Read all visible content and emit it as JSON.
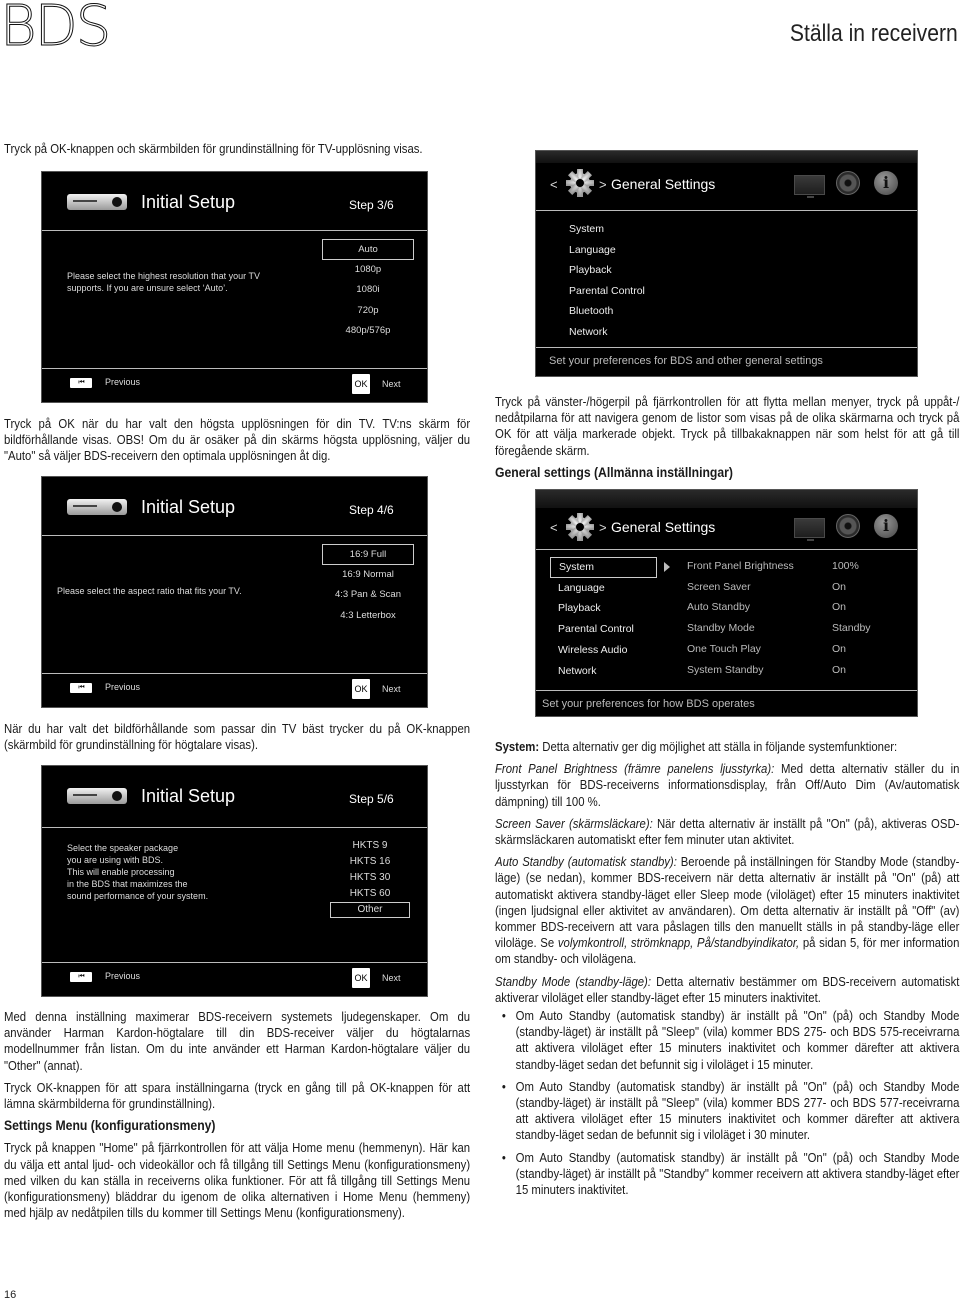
{
  "header": {
    "brand": "BDS",
    "section_title": "Ställa in receivern"
  },
  "left": {
    "intro": "Tryck på OK-knappen och skärmbilden för grundinställning för TV-upplösning visas.",
    "after_step3": "Tryck på OK när du har valt den högsta upplösningen för din TV. TV:ns skärm för bildförhållande visas. OBS! Om du är osäker på din skärms högsta upplösning, väljer du \"Auto\" så väljer BDS-receivern den optimala upplösningen åt dig.",
    "after_step4": "När du har valt det bildförhållande som passar din TV bäst trycker du på OK-knappen (skärmbild för grundinställning för högtalare visas).",
    "after_step5_a": "Med denna inställning maximerar BDS-receivern systemets ljudegenskaper. Om du använder Harman Kardon-högtalare till din BDS-receiver väljer du högtalarnas modellnummer från listan. Om du inte använder ett Harman Kardon-högtalare väljer du \"Other\" (annat).",
    "after_step5_b": "Tryck OK-knappen för att spara inställningarna (tryck en gång till på OK-knappen för att lämna skärmbilderna för grundinställning).",
    "settings_heading": "Settings Menu (konfigurationsmeny)",
    "settings_body": "Tryck på knappen \"Home\" på fjärrkontrollen för att välja Home menu (hemmenyn). Här kan du välja ett antal ljud- och videokällor och få tillgång till Settings Menu (konfigurationsmeny) med vilken du kan ställa in receiverns olika funktioner. För att få tillgång till Settings Menu (konfigurationsmeny) bläddrar du igenom de olika alternativen i Home Menu (hemmeny) med hjälp av nedåtpilen tills du kommer till Settings Menu (konfigurationsmeny)."
  },
  "setup_screens": [
    {
      "title": "Initial Setup",
      "step": "Step 3/6",
      "message": "Please select the highest resolution that your TV supports. If you are unsure select ‘Auto’.",
      "options": [
        "Auto",
        "1080p",
        "1080i",
        "720p",
        "480p/576p"
      ],
      "selected": 0,
      "prev_icon": "⏮",
      "prev_label": "Previous",
      "ok_label": "OK",
      "next_label": "Next"
    },
    {
      "title": "Initial Setup",
      "step": "Step 4/6",
      "message": "Please select the aspect ratio that fits your TV.",
      "options": [
        "16:9 Full",
        "16:9 Normal",
        "4:3 Pan & Scan",
        "4:3 Letterbox"
      ],
      "selected": 0,
      "prev_icon": "⏮",
      "prev_label": "Previous",
      "ok_label": "OK",
      "next_label": "Next"
    },
    {
      "title": "Initial Setup",
      "step": "Step 5/6",
      "message_lines": [
        "Select the speaker package",
        "you are using with BDS.",
        "This will enable processing",
        "in the BDS that maximizes the",
        "sound performance of your system."
      ],
      "options": [
        "HKTS 9",
        "HKTS 16",
        "HKTS 30",
        "HKTS 60",
        "Other"
      ],
      "selected": 4,
      "prev_icon": "⏮",
      "prev_label": "Previous",
      "ok_label": "OK",
      "next_label": "Next"
    }
  ],
  "general_settings_1": {
    "back": "<",
    "forward": ">",
    "title": "General Settings",
    "icons": [
      "gear-icon",
      "tv-icon",
      "disc-icon",
      "info-icon"
    ],
    "info_glyph": "i",
    "menu": [
      "System",
      "Language",
      "Playback",
      "Parental Control",
      "Bluetooth",
      "Network"
    ],
    "footer": "Set your preferences for BDS and other general settings"
  },
  "right": {
    "nav_text": "Tryck på vänster-/högerpil på fjärrkontrollen för att flytta mellan menyer, tryck på uppåt-/ nedåtpilarna för att navigera genom de listor som visas på de olika skärmarna och tryck på OK för att välja markerade objekt. Tryck på tillbakaknappen när som helst för att gå till föregående skärm.",
    "general_heading": "General settings (Allmänna inställningar)",
    "system_label": "System:",
    "system_text": " Detta alternativ ger dig möjlighet att ställa in följande systemfunktioner:",
    "fpb_label": "Front Panel Brightness (främre panelens ljusstyrka):",
    "fpb_text": " Med detta alternativ ställer du in ljusstyrkan för BDS-receiverns informationsdisplay, från Off/Auto Dim (Av/automatisk dämpning) till 100 %.",
    "ss_label": "Screen Saver (skärmsläckare):",
    "ss_text": " När detta alternativ är inställt på \"On\" (på), aktiveras OSD-skärmsläckaren automatiskt efter fem minuter utan aktivitet.",
    "as_label": "Auto Standby (automatisk standby):",
    "as_text_1": " Beroende på inställningen för Standby Mode (standby-läge) (se nedan), kommer BDS-receivern när detta alternativ är inställt på \"On\" (på) att automatiskt aktivera standby-läget eller Sleep mode (viloläget) efter 15 minuters inaktivitet (ingen ljudsignal eller aktivitet av användaren). Om detta alternativ är inställt på \"Off\" (av) kommer BDS-receivern att vara påslagen tills den manuellt ställs in på standby-läge eller viloläge. Se ",
    "as_ref": "volymkontroll, strömknapp, På/standbyindikator,",
    "as_text_2": " på sidan 5, för mer information om standby- och vilolägena.",
    "sm_label": "Standby Mode (standby-läge):",
    "sm_text": " Detta alternativ bestämmer om BDS-receivern automatiskt aktiverar viloläget eller standby-läget efter 15 minuters inaktivitet.",
    "bullets": [
      "Om Auto Standby (automatisk standby) är inställt på \"On\" (på) och Standby Mode (standby-läget) är inställt på \"Sleep\" (vila) kommer BDS 275- och BDS 575-receivrarna att aktivera viloläget efter 15 minuters inaktivitet och kommer därefter att aktivera standby-läget sedan det befunnit sig i viloläget i 15 minuter.",
      "Om Auto Standby (automatisk standby) är inställt på \"On\" (på) och Standby Mode (standby-läget) är inställt på \"Sleep\" (vila) kommer BDS 277- och BDS 577-receivrarna att aktivera viloläget efter 15 minuters inaktivitet och kommer därefter att aktivera standby-läget sedan de befunnit sig i viloläget i 30 minuter.",
      "Om Auto Standby (automatisk standby) är inställt på \"On\" (på) och Standby Mode (standby-läget) är inställt på \"Standby\" kommer receivern att aktivera standby-läget efter 15 minuters inaktivitet."
    ]
  },
  "general_settings_2": {
    "back": "<",
    "forward": ">",
    "title": "General Settings",
    "info_glyph": "i",
    "menu": [
      "System",
      "Language",
      "Playback",
      "Parental Control",
      "Wireless Audio",
      "Network"
    ],
    "selected": 0,
    "settings": [
      {
        "name": "Front Panel Brightness",
        "value": "100%"
      },
      {
        "name": "Screen Saver",
        "value": "On"
      },
      {
        "name": "Auto Standby",
        "value": "On"
      },
      {
        "name": "Standby Mode",
        "value": "Standby"
      },
      {
        "name": "One Touch Play",
        "value": "On"
      },
      {
        "name": "System Standby",
        "value": "On"
      }
    ],
    "footer": "Set your preferences for how BDS operates"
  },
  "page_number": "16"
}
